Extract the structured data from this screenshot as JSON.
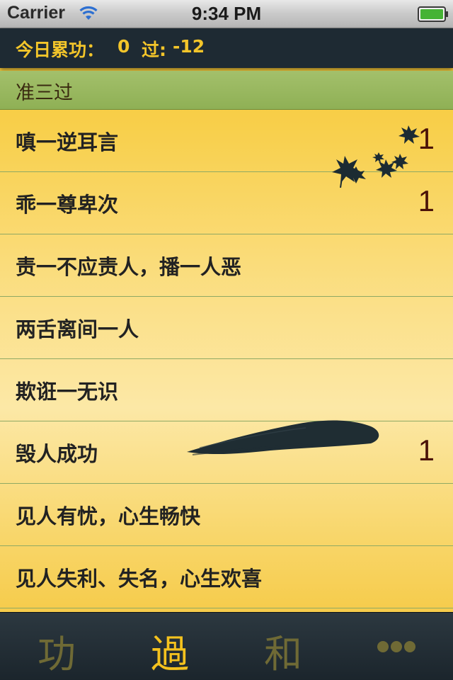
{
  "status_bar": {
    "carrier": "Carrier",
    "time": "9:34 PM",
    "wifi_icon": "wifi-icon",
    "battery_icon": "battery-icon"
  },
  "header": {
    "merit_label": "今日累功：",
    "merit_value": "0",
    "demerit_label": "过:",
    "demerit_value": "-12"
  },
  "section": {
    "title": "准三过"
  },
  "rows": [
    {
      "label": "嗔一逆耳言",
      "count": "1"
    },
    {
      "label": "乖一尊卑次",
      "count": "1"
    },
    {
      "label": "责一不应责人，播一人恶",
      "count": ""
    },
    {
      "label": "两舌离间一人",
      "count": ""
    },
    {
      "label": "欺诳一无识",
      "count": ""
    },
    {
      "label": "毁人成功",
      "count": "1"
    },
    {
      "label": "见人有忧，心生畅快",
      "count": ""
    },
    {
      "label": "见人失利、失名，心生欢喜",
      "count": ""
    }
  ],
  "tabs": [
    {
      "glyph": "功",
      "name": "tab-merit",
      "selected": false
    },
    {
      "glyph": "過",
      "name": "tab-demerit",
      "selected": true
    },
    {
      "glyph": "和",
      "name": "tab-harmony",
      "selected": false
    },
    {
      "glyph": "",
      "name": "tab-more",
      "icon": "more-icon",
      "selected": false
    }
  ],
  "colors": {
    "header_bg": "#1e2a33",
    "header_text": "#f3c52a",
    "section_bg": "#9ab862",
    "count_text": "#4a1208",
    "tab_selected": "#f4c21e",
    "tab_unselected": "#6f6a35"
  }
}
